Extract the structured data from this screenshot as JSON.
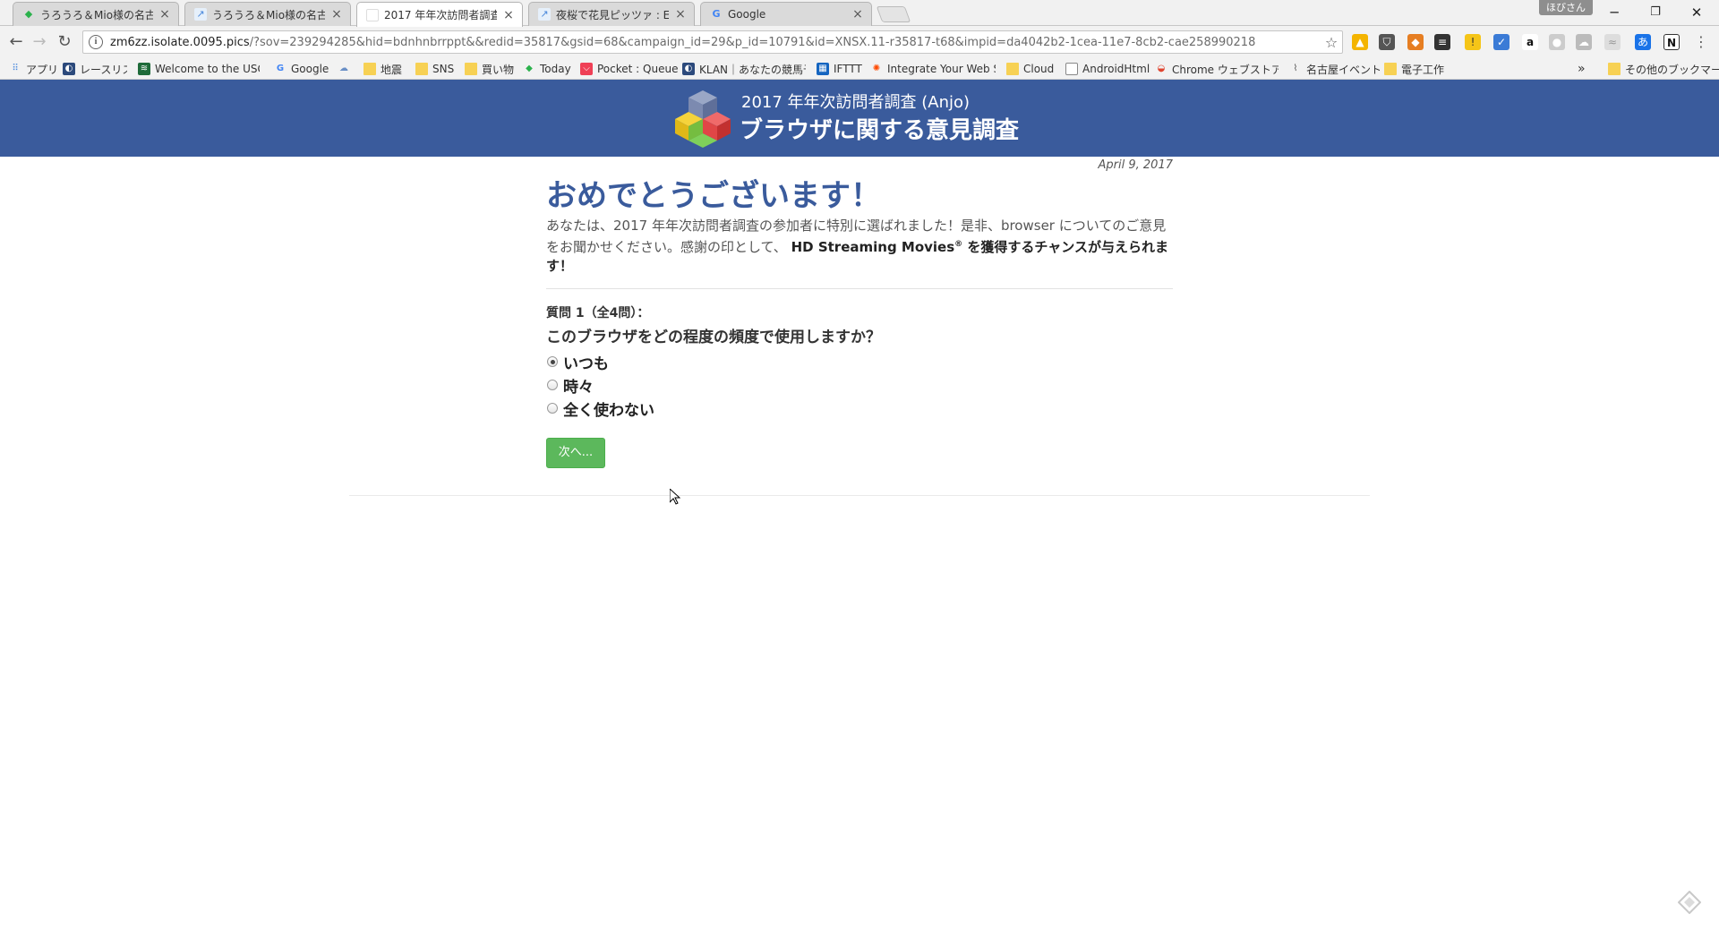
{
  "tabs": [
    {
      "label": "うろうろ＆Mio様の名古屋を",
      "active": false
    },
    {
      "label": "うろうろ＆Mio様の名古屋を",
      "active": false
    },
    {
      "label": "2017 年年次訪問者調査",
      "active": true
    },
    {
      "label": "夜桜で花見ピッツァ : Eat and",
      "active": false
    },
    {
      "label": "Google",
      "active": false
    }
  ],
  "profile_name": "ほびさん",
  "address_bar": {
    "host": "zm6zz.isolate.0095.pics",
    "path": "/?sov=239294285&hid=bdnhnbrrppt&&redid=35817&gsid=68&campaign_id=29&p_id=10791&id=XNSX.11-r35817-t68&impid=da4042b2-1cea-11e7-8cb2-cae258990218"
  },
  "bookmarks": [
    {
      "label": "アプリ",
      "icon": "apps-grid-icon"
    },
    {
      "label": "レースリスト",
      "icon": "page-icon"
    },
    {
      "label": "Welcome to the USGS",
      "icon": "usgs-icon"
    },
    {
      "label": "Google",
      "icon": "google-icon"
    },
    {
      "label": "",
      "icon": "cloud-icon"
    },
    {
      "label": "地震",
      "icon": "folder-icon"
    },
    {
      "label": "SNS",
      "icon": "folder-icon"
    },
    {
      "label": "買い物",
      "icon": "folder-icon"
    },
    {
      "label": "Today",
      "icon": "today-icon"
    },
    {
      "label": "Pocket : Queue",
      "icon": "pocket-icon"
    },
    {
      "label": "KLAN｜あなたの競馬予",
      "icon": "klan-icon"
    },
    {
      "label": "IFTTT",
      "icon": "ifttt-icon"
    },
    {
      "label": "Integrate Your Web Se",
      "icon": "zapier-icon"
    },
    {
      "label": "Cloud",
      "icon": "folder-icon"
    },
    {
      "label": "AndroidHtml",
      "icon": "page-icon"
    },
    {
      "label": "Chrome ウェブストア - W",
      "icon": "webstore-icon"
    },
    {
      "label": "名古屋イベント",
      "icon": "clip-icon"
    },
    {
      "label": "電子工作",
      "icon": "folder-icon"
    }
  ],
  "bookmarks_more": "»",
  "other_bookmarks": "その他のブックマーク",
  "banner": {
    "subtitle": "2017 年年次訪問者調査 (Anjo)",
    "title": "ブラウザに関する意見調査"
  },
  "survey": {
    "date": "April 9, 2017",
    "headline": "おめでとうございます！",
    "intro_text": "あなたは、2017 年年次訪問者調査の参加者に特別に選ばれました！是非、browser についてのご意見をお聞かせください。感謝の印として、",
    "intro_bold": "HD Streaming Movies",
    "intro_reg": "®",
    "intro_bold_end": "を獲得するチャンスが与えられます！",
    "question_number": "質問 1（全4問）：",
    "question_text": "このブラウザをどの程度の頻度で使用しますか？",
    "options": [
      {
        "label": "いつも",
        "checked": true
      },
      {
        "label": "時々",
        "checked": false
      },
      {
        "label": "全く使わない",
        "checked": false
      }
    ],
    "next_button": "次へ..."
  },
  "colors": {
    "banner_bg": "#3a5b9c",
    "headline": "#3a5b9c",
    "next_button": "#5cb85c"
  }
}
